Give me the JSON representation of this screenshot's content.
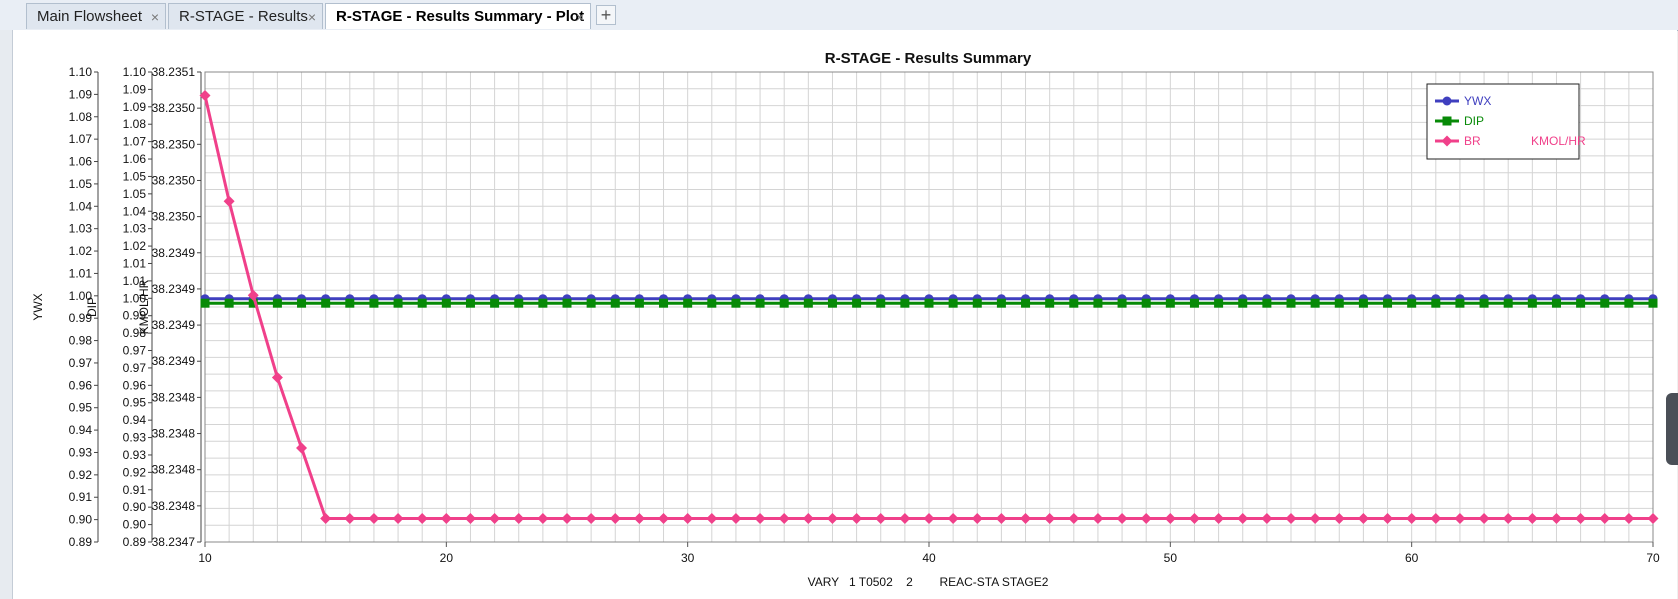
{
  "tabs": [
    {
      "label": "Main Flowsheet",
      "close": "×"
    },
    {
      "label": "R-STAGE - Results",
      "close": "×"
    },
    {
      "label": "R-STAGE - Results Summary - Plot",
      "close": "×"
    }
  ],
  "tab_add": "+",
  "chart_data": {
    "type": "line",
    "title": "R-STAGE - Results Summary",
    "xlabel": "VARY   1 T0502    2        REAC-STA STAGE2",
    "xlim": [
      10,
      70
    ],
    "xticks": [
      10,
      20,
      30,
      40,
      50,
      60,
      70
    ],
    "x": [
      10,
      11,
      12,
      13,
      14,
      15,
      16,
      17,
      18,
      19,
      20,
      21,
      22,
      23,
      24,
      25,
      26,
      27,
      28,
      29,
      30,
      31,
      32,
      33,
      34,
      35,
      36,
      37,
      38,
      39,
      40,
      41,
      42,
      43,
      44,
      45,
      46,
      47,
      48,
      49,
      50,
      51,
      52,
      53,
      54,
      55,
      56,
      57,
      58,
      59,
      60,
      61,
      62,
      63,
      64,
      65,
      66,
      67,
      68,
      69,
      70
    ],
    "axes": [
      {
        "label": "YWX",
        "ylim": [
          0.89,
          1.1
        ],
        "tick_labels": [
          "1.10",
          "1.09",
          "1.08",
          "1.07",
          "1.06",
          "1.05",
          "1.04",
          "1.03",
          "1.02",
          "1.01",
          "1.00",
          "0.99",
          "0.98",
          "0.97",
          "0.96",
          "0.95",
          "0.94",
          "0.93",
          "0.92",
          "0.91",
          "0.90",
          "0.89"
        ]
      },
      {
        "label": "DIP",
        "ylim": [
          0.89,
          1.1
        ],
        "tick_labels": [
          "1.10",
          "1.09",
          "1.09",
          "1.08",
          "1.07",
          "1.06",
          "1.05",
          "1.05",
          "1.04",
          "1.03",
          "1.02",
          "1.01",
          "1.01",
          "1.00",
          "0.99",
          "0.98",
          "0.97",
          "0.97",
          "0.96",
          "0.95",
          "0.94",
          "0.93",
          "0.93",
          "0.92",
          "0.91",
          "0.90",
          "0.90",
          "0.89"
        ]
      },
      {
        "label": "KMOL/HR",
        "ylim": [
          38.2347,
          38.2351
        ],
        "tick_labels": [
          "38.2351",
          "38.2350",
          "38.2350",
          "38.2350",
          "38.2350",
          "38.2349",
          "38.2349",
          "38.2349",
          "38.2349",
          "38.2348",
          "38.2348",
          "38.2348",
          "38.2348",
          "38.2347"
        ]
      }
    ],
    "series": [
      {
        "name": "YWX",
        "axis": 0,
        "color": "#3f3fbf",
        "marker": "circle",
        "values": [
          0.9987,
          0.9987,
          0.9987,
          0.9987,
          0.9987,
          0.9987,
          0.9987,
          0.9987,
          0.9987,
          0.9987,
          0.9987,
          0.9987,
          0.9987,
          0.9987,
          0.9987,
          0.9987,
          0.9987,
          0.9987,
          0.9987,
          0.9987,
          0.9987,
          0.9987,
          0.9987,
          0.9987,
          0.9987,
          0.9987,
          0.9987,
          0.9987,
          0.9987,
          0.9987,
          0.9987,
          0.9987,
          0.9987,
          0.9987,
          0.9987,
          0.9987,
          0.9987,
          0.9987,
          0.9987,
          0.9987,
          0.9987,
          0.9987,
          0.9987,
          0.9987,
          0.9987,
          0.9987,
          0.9987,
          0.9987,
          0.9987,
          0.9987,
          0.9987,
          0.9987,
          0.9987,
          0.9987,
          0.9987,
          0.9987,
          0.9987,
          0.9987,
          0.9987,
          0.9987,
          0.9987
        ]
      },
      {
        "name": "DIP",
        "axis": 1,
        "color": "#078a07",
        "marker": "square",
        "values": [
          0.9967,
          0.9967,
          0.9967,
          0.9967,
          0.9967,
          0.9967,
          0.9967,
          0.9967,
          0.9967,
          0.9967,
          0.9967,
          0.9967,
          0.9967,
          0.9967,
          0.9967,
          0.9967,
          0.9967,
          0.9967,
          0.9967,
          0.9967,
          0.9967,
          0.9967,
          0.9967,
          0.9967,
          0.9967,
          0.9967,
          0.9967,
          0.9967,
          0.9967,
          0.9967,
          0.9967,
          0.9967,
          0.9967,
          0.9967,
          0.9967,
          0.9967,
          0.9967,
          0.9967,
          0.9967,
          0.9967,
          0.9967,
          0.9967,
          0.9967,
          0.9967,
          0.9967,
          0.9967,
          0.9967,
          0.9967,
          0.9967,
          0.9967,
          0.9967,
          0.9967,
          0.9967,
          0.9967,
          0.9967,
          0.9967,
          0.9967,
          0.9967,
          0.9967,
          0.9967,
          0.9967
        ]
      },
      {
        "name": "BR",
        "unit": "KMOL/HR",
        "axis": 2,
        "color": "#f0408a",
        "marker": "diamond",
        "values": [
          38.23508,
          38.23499,
          38.23491,
          38.23484,
          38.23478,
          38.23472,
          38.23472,
          38.23472,
          38.23472,
          38.23472,
          38.23472,
          38.23472,
          38.23472,
          38.23472,
          38.23472,
          38.23472,
          38.23472,
          38.23472,
          38.23472,
          38.23472,
          38.23472,
          38.23472,
          38.23472,
          38.23472,
          38.23472,
          38.23472,
          38.23472,
          38.23472,
          38.23472,
          38.23472,
          38.23472,
          38.23472,
          38.23472,
          38.23472,
          38.23472,
          38.23472,
          38.23472,
          38.23472,
          38.23472,
          38.23472,
          38.23472,
          38.23472,
          38.23472,
          38.23472,
          38.23472,
          38.23472,
          38.23472,
          38.23472,
          38.23472,
          38.23472,
          38.23472,
          38.23472,
          38.23472,
          38.23472,
          38.23472,
          38.23472,
          38.23472,
          38.23472,
          38.23472,
          38.23472,
          38.23472
        ]
      }
    ],
    "grid": true,
    "legend_position": "top-right"
  }
}
